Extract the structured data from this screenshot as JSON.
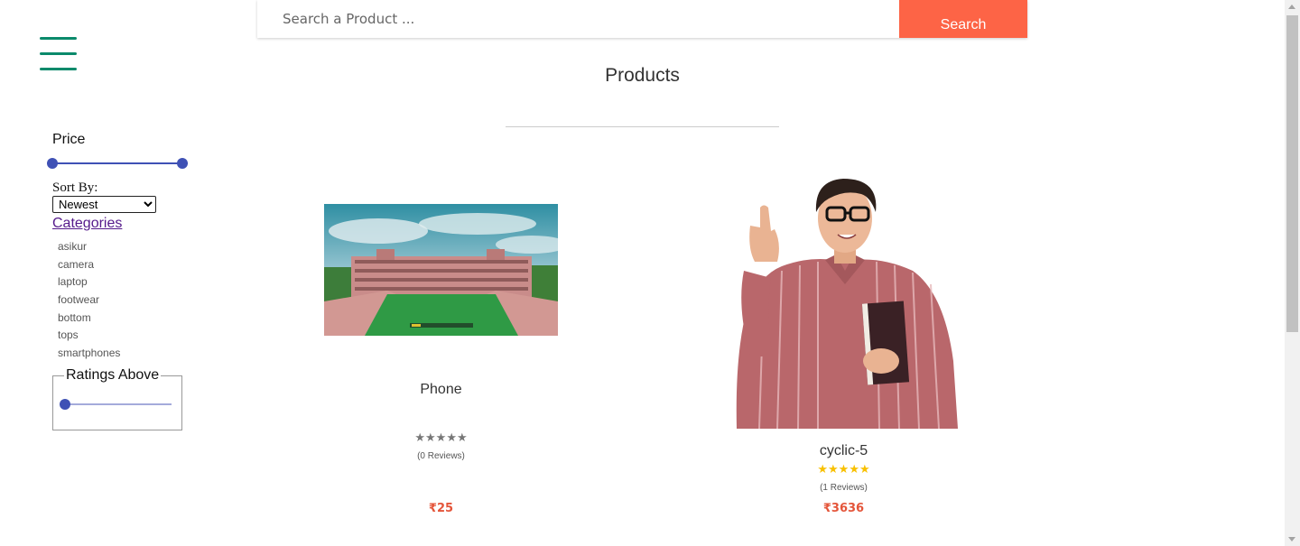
{
  "search": {
    "placeholder": "Search a Product ...",
    "button_label": "Search"
  },
  "page": {
    "title": "Products"
  },
  "filters": {
    "price_label": "Price",
    "sort_label": "Sort By:",
    "sort_selected": "Newest",
    "categories_label": "Categories",
    "categories": [
      "asikur",
      "camera",
      "laptop",
      "footwear",
      "bottom",
      "tops",
      "smartphones"
    ],
    "ratings_label": "Ratings Above"
  },
  "products": [
    {
      "name": "Phone",
      "stars": "★★★★★",
      "rating": 0,
      "reviews": "(0 Reviews)",
      "price": "₹25",
      "image": "campus-building-photo"
    },
    {
      "name": "cyclic-5",
      "stars": "★★★★★",
      "rating": 5,
      "reviews": "(1 Reviews)",
      "price": "₹3636",
      "image": "student-pointing-photo"
    }
  ],
  "colors": {
    "accent": "#fd6446",
    "menu": "#0b8a6b",
    "slider": "#3f51b5",
    "star_filled": "#f8c000",
    "star_empty": "#777777",
    "price": "#e4553a"
  }
}
